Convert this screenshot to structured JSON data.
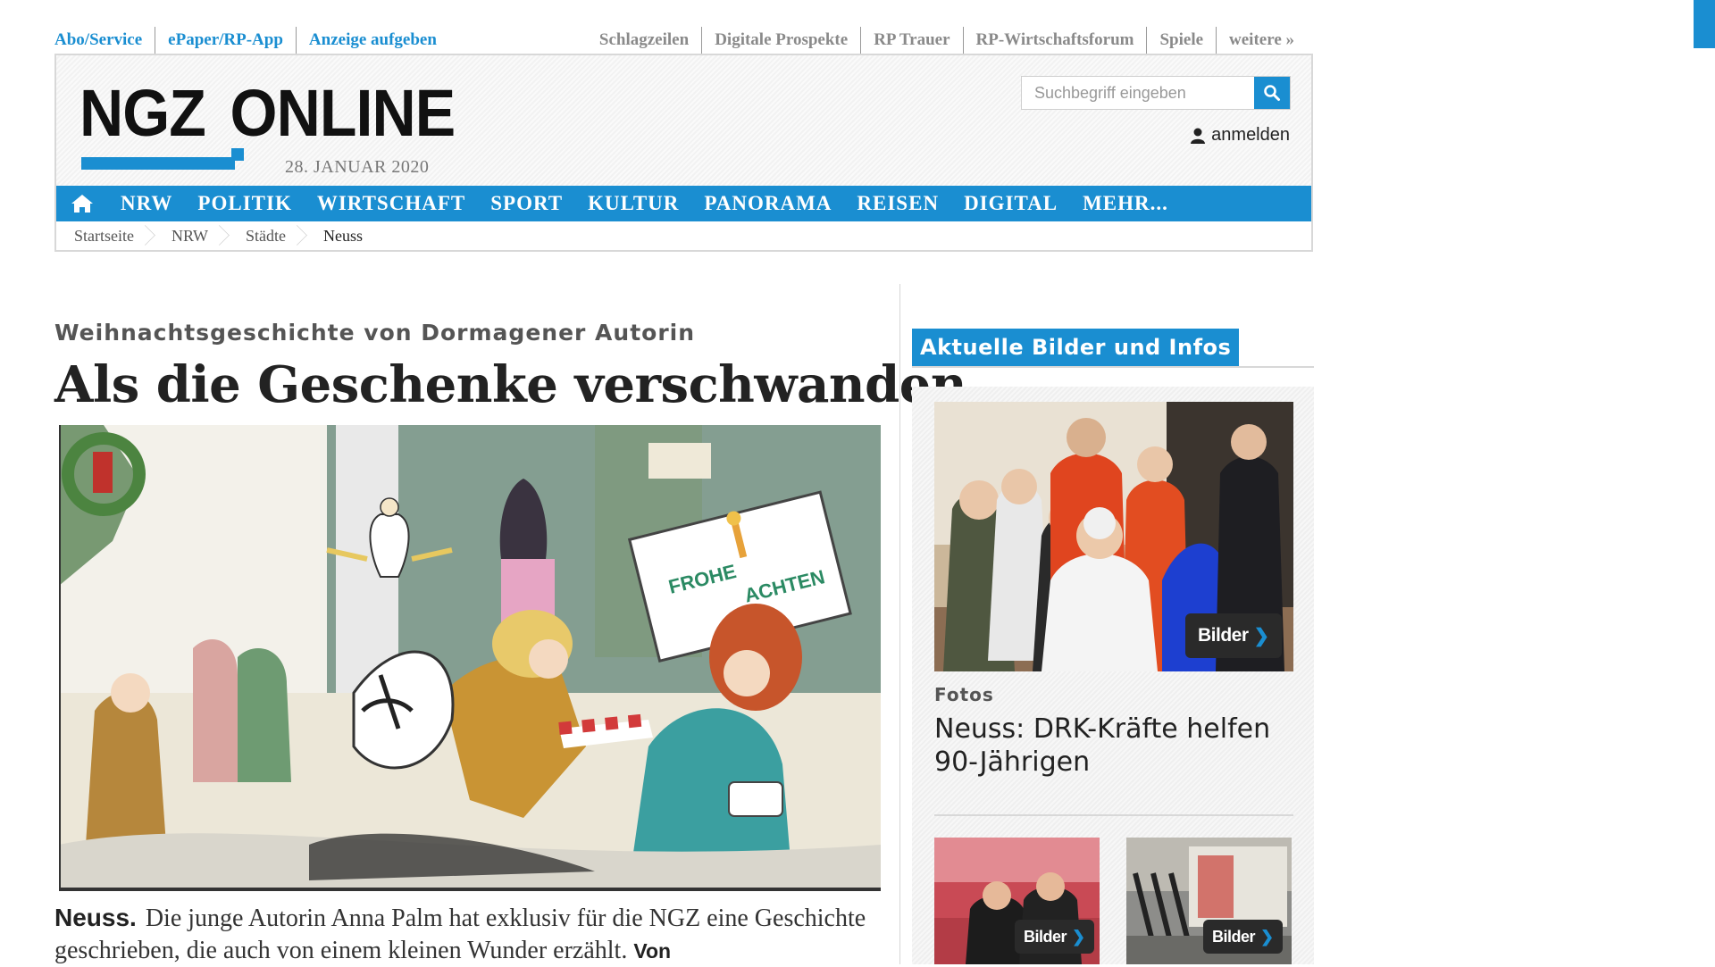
{
  "top_links": {
    "left": [
      "Abo/Service",
      "ePaper/RP-App",
      "Anzeige aufgeben"
    ],
    "right": [
      "Schlagzeilen",
      "Digitale Prospekte",
      "RP Trauer",
      "RP-Wirtschaftsforum",
      "Spiele",
      "weitere »"
    ]
  },
  "header": {
    "logo_left": "NGZ",
    "logo_right": "ONLINE",
    "date": "28. JANUAR 2020",
    "search_placeholder": "Suchbegriff eingeben",
    "login_label": "anmelden"
  },
  "nav": {
    "items": [
      "NRW",
      "POLITIK",
      "WIRTSCHAFT",
      "SPORT",
      "KULTUR",
      "PANORAMA",
      "REISEN",
      "DIGITAL",
      "MEHR..."
    ]
  },
  "breadcrumb": [
    "Startseite",
    "NRW",
    "Städte",
    "Neuss"
  ],
  "article": {
    "kicker": "Weihnachtsgeschichte von Dormagener Autorin",
    "headline": "Als die Geschenke verschwanden",
    "lead_place": "Neuss.",
    "lead_text": "Die junge Autorin Anna Palm hat exklusiv für die NGZ eine Geschichte geschrieben, die auch von einem kleinen Wunder erzählt.",
    "byline": "Von",
    "image_sign_text": "FROHE WEIHNACHTEN"
  },
  "sidebar": {
    "title": "Aktuelle Bilder und Infos",
    "main_teaser": {
      "badge": "Bilder",
      "kicker": "Fotos",
      "title": "Neuss: DRK-Kräfte helfen 90-Jährigen"
    },
    "thumbs": [
      {
        "badge": "Bilder"
      },
      {
        "badge": "Bilder"
      }
    ]
  },
  "colors": {
    "brand_blue": "#1a8ed1",
    "badge_bg": "#2a2a2a"
  }
}
